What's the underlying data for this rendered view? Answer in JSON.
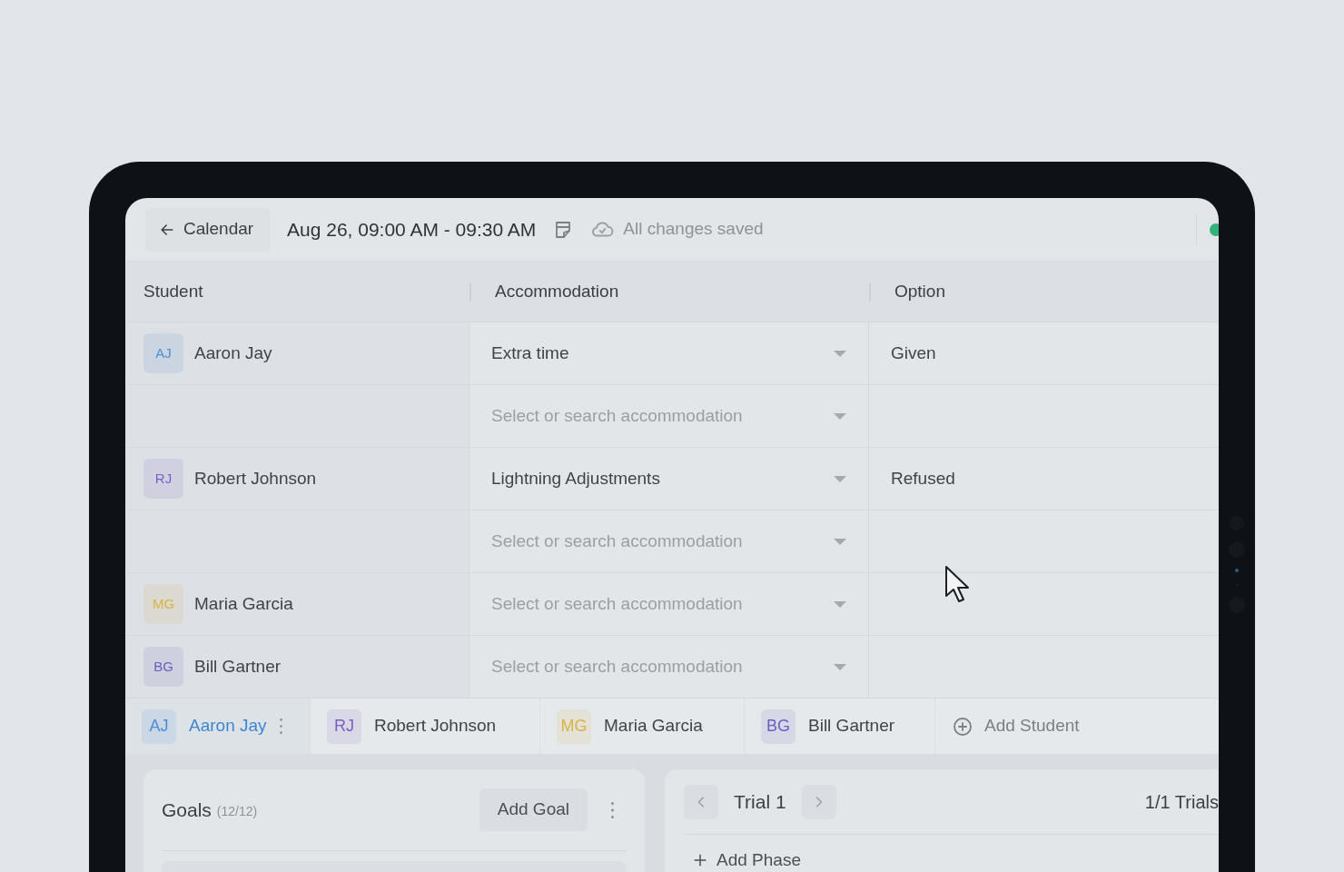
{
  "header": {
    "back_button": "Calendar",
    "datetime": "Aug 26, 09:00 AM - 09:30 AM",
    "save_status": "All changes saved"
  },
  "table": {
    "columns": [
      "Student",
      "Accommodation",
      "Option"
    ],
    "rows": [
      {
        "student": {
          "initials": "AJ",
          "name": "Aaron Jay",
          "color": "#4a8fd6"
        },
        "accommodation": {
          "value": "Extra time"
        },
        "option": "Given"
      },
      {
        "accommodation": {
          "placeholder": "Select or search accommodation"
        }
      },
      {
        "student": {
          "initials": "RJ",
          "name": "Robert Johnson",
          "color": "#7b5fc4"
        },
        "accommodation": {
          "value": "Lightning Adjustments"
        },
        "option": "Refused"
      },
      {
        "accommodation": {
          "placeholder": "Select or search accommodation"
        }
      },
      {
        "student": {
          "initials": "MG",
          "name": "Maria Garcia",
          "color": "#d8b443"
        },
        "accommodation": {
          "placeholder": "Select or search accommodation"
        }
      },
      {
        "student": {
          "initials": "BG",
          "name": "Bill Gartner",
          "color": "#6b5fc0"
        },
        "accommodation": {
          "placeholder": "Select or search accommodation"
        }
      }
    ]
  },
  "student_tabs": [
    {
      "initials": "AJ",
      "name": "Aaron Jay",
      "color": "#4a8fd6",
      "selected": true
    },
    {
      "initials": "RJ",
      "name": "Robert Johnson",
      "color": "#7b5fc4",
      "selected": false
    },
    {
      "initials": "MG",
      "name": "Maria Garcia",
      "color": "#d8b443",
      "selected": false
    },
    {
      "initials": "BG",
      "name": "Bill Gartner",
      "color": "#6b5fc0",
      "selected": false
    }
  ],
  "add_student": "Add Student",
  "goals": {
    "title": "Goals",
    "count": "(12/12)",
    "add_button": "Add Goal"
  },
  "trial": {
    "title": "Trial 1",
    "count": "1/1 Trials",
    "add_phase": "Add Phase"
  }
}
